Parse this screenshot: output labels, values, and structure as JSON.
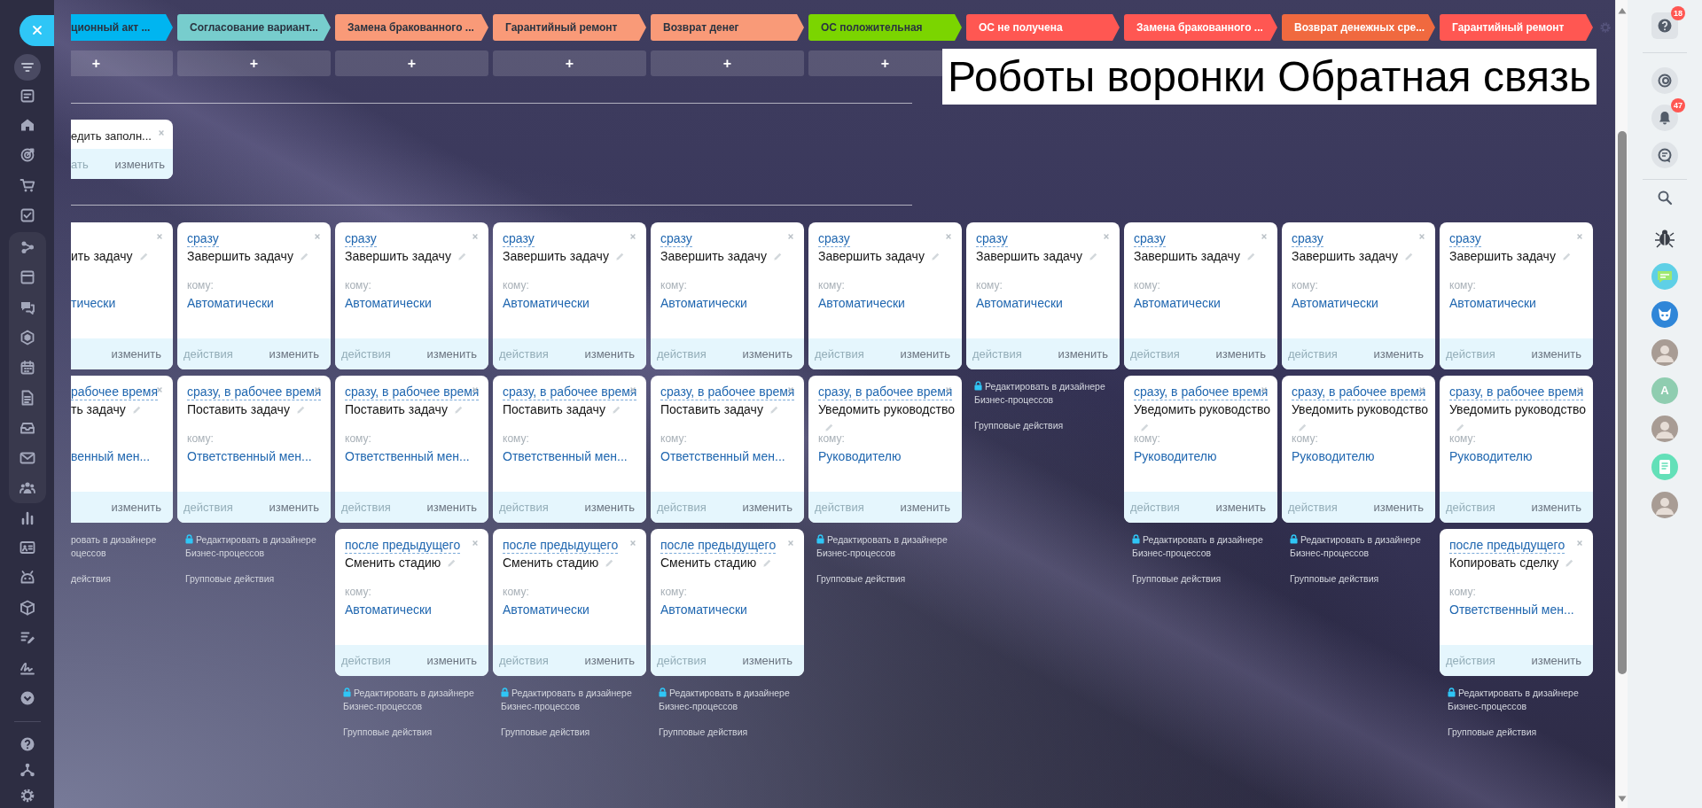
{
  "stages": [
    {
      "title": "ционный акт ...",
      "color": "#00b5f0",
      "add_button": "+"
    },
    {
      "title": "Согласование вариант...",
      "color": "#77cdcd",
      "add_button": "+"
    },
    {
      "title": "Замена бракованного ...",
      "color": "#f99a78",
      "add_button": "+"
    },
    {
      "title": "Гарантийный ремонт",
      "color": "#f99a78",
      "add_button": "+"
    },
    {
      "title": "Возврат денег",
      "color": "#f99a78",
      "add_button": "+"
    },
    {
      "title": "ОС положительная",
      "color": "#7bd500",
      "add_button": "+"
    },
    {
      "title": "ОС не получена",
      "color": "#ff5752"
    },
    {
      "title": "Замена бракованного ...",
      "color": "#ff5752"
    },
    {
      "title": "Возврат денежных сре...",
      "color": "#f0693f"
    },
    {
      "title": "Гарантийный ремонт",
      "color": "#ff5752"
    }
  ],
  "title_overlay": "Роботы воронки Обратная связь",
  "trigger_card": {
    "title": "едить заполн...",
    "actions": "ать",
    "edit": "изменить"
  },
  "columns": [
    {
      "cut": true,
      "robots": [
        {
          "title": "ить задачу",
          "recipient": "тически",
          "edit": "изменить"
        },
        {
          "delay": "рабочее время",
          "title": "ть задачу",
          "recipient": "венный мен...",
          "edit": "изменить"
        }
      ],
      "footer": {
        "locked": false,
        "designer_link": "ровать в дизайнере оцессов",
        "group_actions": "действия"
      }
    },
    {
      "cut": false,
      "robots": [
        {
          "delay": "сразу",
          "title": "Завершить задачу",
          "recipient_label": "кому:",
          "recipient": "Автоматически",
          "actions": "действия",
          "edit": "изменить"
        },
        {
          "delay": "сразу, в рабочее время",
          "title": "Поставить задачу",
          "recipient_label": "кому:",
          "recipient": "Ответственный мен...",
          "actions": "действия",
          "edit": "изменить"
        }
      ],
      "footer": {
        "locked": true,
        "designer_link": "Редактировать в дизайнере Бизнес-процессов",
        "group_actions": "Групповые действия"
      }
    },
    {
      "cut": false,
      "robots": [
        {
          "delay": "сразу",
          "title": "Завершить задачу",
          "recipient_label": "кому:",
          "recipient": "Автоматически",
          "actions": "действия",
          "edit": "изменить"
        },
        {
          "delay": "сразу, в рабочее время",
          "title": "Поставить задачу",
          "recipient_label": "кому:",
          "recipient": "Ответственный мен...",
          "actions": "действия",
          "edit": "изменить"
        },
        {
          "delay": "после предыдущего",
          "title": "Сменить стадию",
          "recipient_label": "кому:",
          "recipient": "Автоматически",
          "actions": "действия",
          "edit": "изменить"
        }
      ],
      "footer": {
        "locked": true,
        "designer_link": "Редактировать в дизайнере Бизнес-процессов",
        "group_actions": "Групповые действия"
      }
    },
    {
      "cut": false,
      "robots": [
        {
          "delay": "сразу",
          "title": "Завершить задачу",
          "recipient_label": "кому:",
          "recipient": "Автоматически",
          "actions": "действия",
          "edit": "изменить"
        },
        {
          "delay": "сразу, в рабочее время",
          "title": "Поставить задачу",
          "recipient_label": "кому:",
          "recipient": "Ответственный мен...",
          "actions": "действия",
          "edit": "изменить"
        },
        {
          "delay": "после предыдущего",
          "title": "Сменить стадию",
          "recipient_label": "кому:",
          "recipient": "Автоматически",
          "actions": "действия",
          "edit": "изменить"
        }
      ],
      "footer": {
        "locked": true,
        "designer_link": "Редактировать в дизайнере Бизнес-процессов",
        "group_actions": "Групповые действия"
      }
    },
    {
      "cut": false,
      "robots": [
        {
          "delay": "сразу",
          "title": "Завершить задачу",
          "recipient_label": "кому:",
          "recipient": "Автоматически",
          "actions": "действия",
          "edit": "изменить"
        },
        {
          "delay": "сразу, в рабочее время",
          "title": "Поставить задачу",
          "recipient_label": "кому:",
          "recipient": "Ответственный мен...",
          "actions": "действия",
          "edit": "изменить"
        },
        {
          "delay": "после предыдущего",
          "title": "Сменить стадию",
          "recipient_label": "кому:",
          "recipient": "Автоматически",
          "actions": "действия",
          "edit": "изменить"
        }
      ],
      "footer": {
        "locked": true,
        "designer_link": "Редактировать в дизайнере Бизнес-процессов",
        "group_actions": "Групповые действия"
      }
    },
    {
      "cut": false,
      "robots": [
        {
          "delay": "сразу",
          "title": "Завершить задачу",
          "recipient_label": "кому:",
          "recipient": "Автоматически",
          "actions": "действия",
          "edit": "изменить"
        },
        {
          "delay": "сразу, в рабочее время",
          "title": "Уведомить руководство",
          "recipient_label": "кому:",
          "recipient": "Руководителю",
          "actions": "действия",
          "edit": "изменить"
        }
      ],
      "footer": {
        "locked": true,
        "designer_link": "Редактировать в дизайнере Бизнес-процессов",
        "group_actions": "Групповые действия"
      }
    },
    {
      "cut": false,
      "robots": [
        {
          "delay": "сразу",
          "title": "Завершить задачу",
          "recipient_label": "кому:",
          "recipient": "Автоматически",
          "actions": "действия",
          "edit": "изменить"
        }
      ],
      "footer": {
        "locked": true,
        "designer_link": "Редактировать в дизайнере Бизнес-процессов",
        "group_actions": "Групповые действия"
      }
    },
    {
      "cut": false,
      "robots": [
        {
          "delay": "сразу",
          "title": "Завершить задачу",
          "recipient_label": "кому:",
          "recipient": "Автоматически",
          "actions": "действия",
          "edit": "изменить"
        },
        {
          "delay": "сразу, в рабочее время",
          "title": "Уведомить руководство",
          "recipient_label": "кому:",
          "recipient": "Руководителю",
          "actions": "действия",
          "edit": "изменить"
        }
      ],
      "footer": {
        "locked": true,
        "designer_link": "Редактировать в дизайнере Бизнес-процессов",
        "group_actions": "Групповые действия"
      }
    },
    {
      "cut": false,
      "robots": [
        {
          "delay": "сразу",
          "title": "Завершить задачу",
          "recipient_label": "кому:",
          "recipient": "Автоматически",
          "actions": "действия",
          "edit": "изменить"
        },
        {
          "delay": "сразу, в рабочее время",
          "title": "Уведомить руководство",
          "recipient_label": "кому:",
          "recipient": "Руководителю",
          "actions": "действия",
          "edit": "изменить"
        }
      ],
      "footer": {
        "locked": true,
        "designer_link": "Редактировать в дизайнере Бизнес-процессов",
        "group_actions": "Групповые действия"
      }
    },
    {
      "cut": false,
      "robots": [
        {
          "delay": "сразу",
          "title": "Завершить задачу",
          "recipient_label": "кому:",
          "recipient": "Автоматически",
          "actions": "действия",
          "edit": "изменить"
        },
        {
          "delay": "сразу, в рабочее время",
          "title": "Уведомить руководство",
          "recipient_label": "кому:",
          "recipient": "Руководителю",
          "actions": "действия",
          "edit": "изменить"
        },
        {
          "delay": "после предыдущего",
          "title": "Копировать сделку",
          "recipient_label": "кому:",
          "recipient": "Ответственный мен...",
          "actions": "действия",
          "edit": "изменить"
        }
      ],
      "footer": {
        "locked": true,
        "designer_link": "Редактировать в дизайнере Бизнес-процессов",
        "group_actions": "Групповые действия"
      }
    }
  ],
  "right_sidebar": {
    "help_badge": "18",
    "notification_badge": "47",
    "contacts": [
      {
        "kind": "bug"
      },
      {
        "kind": "chat"
      },
      {
        "kind": "bot"
      },
      {
        "kind": "photo"
      },
      {
        "kind": "letter",
        "letter": "A"
      },
      {
        "kind": "photo"
      },
      {
        "kind": "doc"
      },
      {
        "kind": "photo"
      }
    ]
  }
}
